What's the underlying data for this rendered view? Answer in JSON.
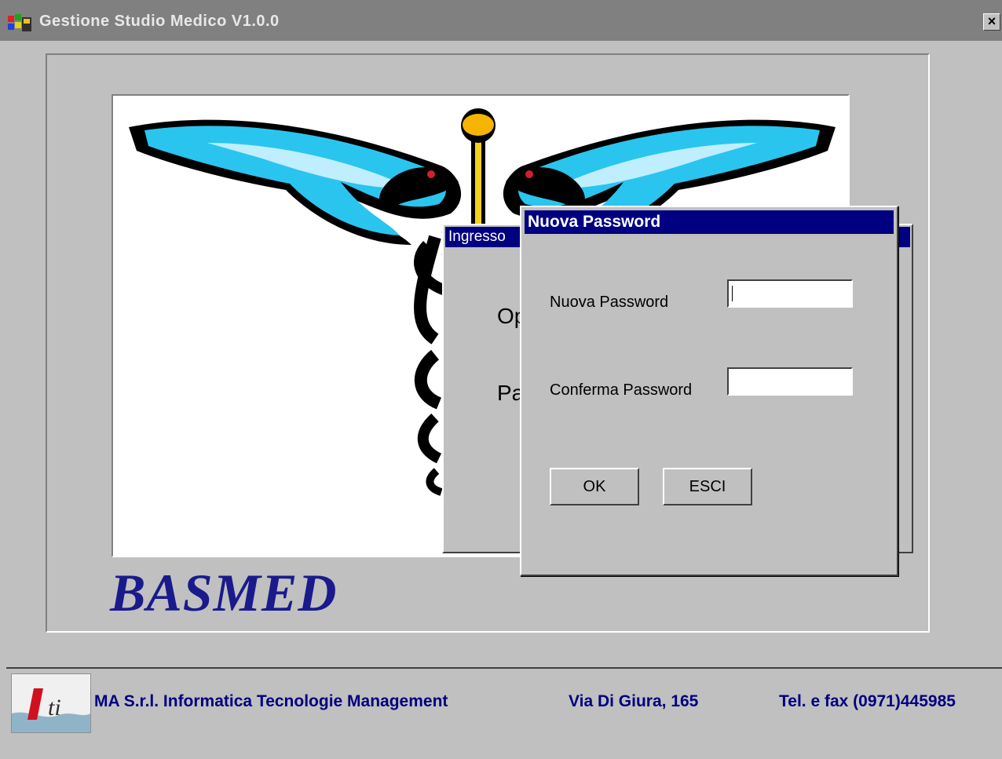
{
  "window": {
    "title": "Gestione Studio Medico V1.0.0",
    "close_label": "×"
  },
  "brand": {
    "name": "BASMED"
  },
  "background_dialog": {
    "title": "Ingresso",
    "label_1": "Op",
    "label_2": "Pa"
  },
  "dialog": {
    "title": "Nuova Password",
    "new_password_label": "Nuova Password",
    "new_password_value": "",
    "confirm_password_label": "Conferma Password",
    "confirm_password_value": "",
    "ok_label": "OK",
    "esci_label": "ESCI"
  },
  "footer": {
    "company": "MA S.r.l.  Informatica Tecnologie Management",
    "address": "Via Di Giura, 165",
    "phone": "Tel. e fax (0971)445985"
  },
  "colors": {
    "titlebar_inactive": "#808080",
    "dialog_title": "#000080",
    "brand_text": "#1a1a8c",
    "footer_text": "#000080",
    "face": "#c0c0c0"
  }
}
